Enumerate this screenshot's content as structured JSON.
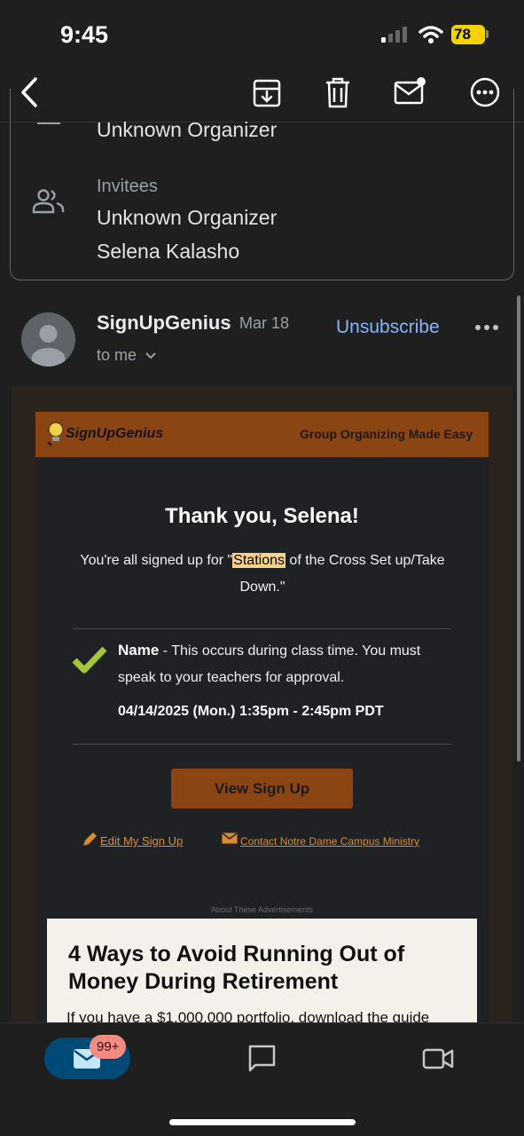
{
  "status_bar": {
    "time": "9:45",
    "battery": "78"
  },
  "event_card": {
    "organizer": "Unknown Organizer",
    "invitees_label": "Invitees",
    "invitees": [
      "Unknown Organizer",
      "Selena Kalasho"
    ]
  },
  "message": {
    "sender": "SignUpGenius",
    "date": "Mar 18",
    "recipient": "to me",
    "unsubscribe": "Unsubscribe"
  },
  "email": {
    "logo": "SignUpGenius",
    "tagline": "Group Organizing Made Easy",
    "heading": "Thank you, Selena!",
    "signed_prefix": "You're all signed up for \"",
    "signed_highlight": "Stations",
    "signed_suffix": " of the Cross Set up/Take Down.\"",
    "slot_name": "Name",
    "slot_desc": " - This occurs during class time. You must speak to your teachers for approval.",
    "slot_datetime": "04/14/2025 (Mon.) 1:35pm - 2:45pm PDT",
    "view_button": "View Sign Up",
    "edit_link": "Edit My Sign Up",
    "contact_link": "Contact Notre Dame Campus Ministry",
    "ads_label": "About These Advertisements",
    "ad_title": "4 Ways to Avoid Running Out of Money During Retirement",
    "ad_text": "If you have a $1,000,000 portfolio, download the guide"
  },
  "bottom_nav": {
    "badge": "99+"
  },
  "colors": {
    "accent_brown": "#8b4513",
    "link_blue": "#8ab4f8",
    "check_green": "#a4c639",
    "highlight": "#f5d28a"
  }
}
